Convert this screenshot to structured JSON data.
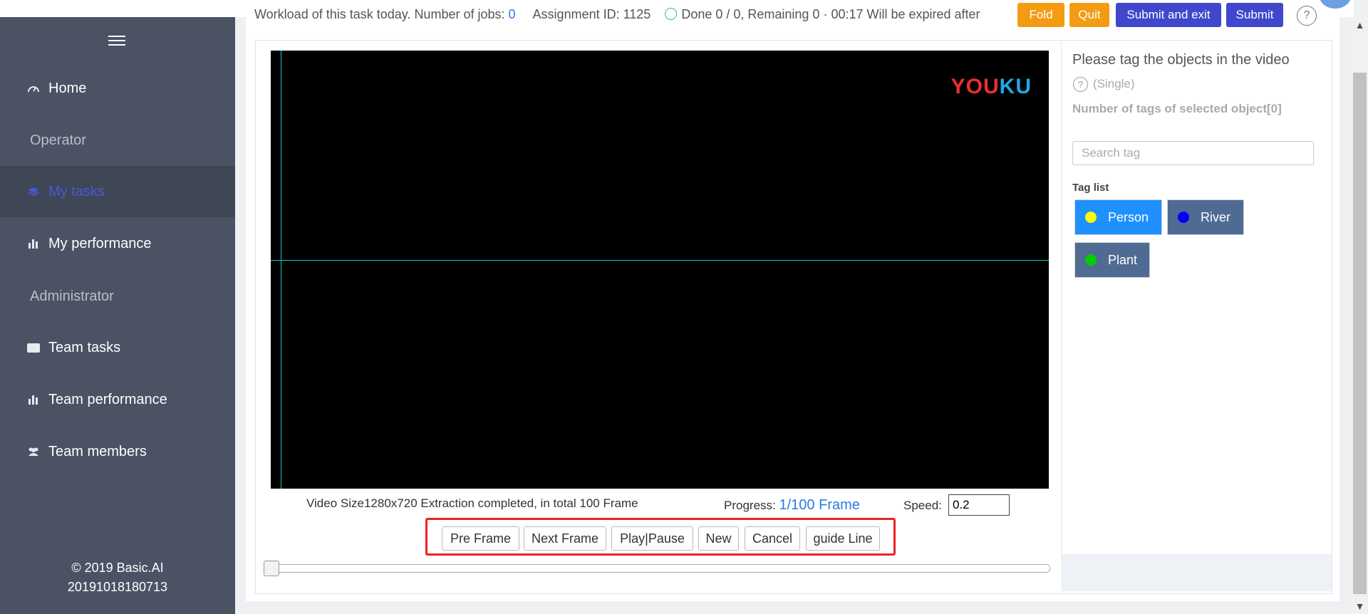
{
  "header": {
    "workload_text": "Workload of this task today. Number of jobs:",
    "jobs_count": "0",
    "assignment_text": "Assignment ID: 1125",
    "status_text": "Done 0 / 0, Remaining 0 · 00:17 Will be expired after",
    "buttons": {
      "fold": "Fold",
      "quit": "Quit",
      "submit_exit": "Submit and exit",
      "submit": "Submit"
    },
    "help": "?"
  },
  "sidebar": {
    "items": [
      {
        "label": "Home",
        "icon": "dashboard-icon"
      },
      {
        "label": "My tasks",
        "icon": "layers-icon",
        "active": true
      },
      {
        "label": "My performance",
        "icon": "bar-chart-icon"
      },
      {
        "label": "Team tasks",
        "icon": "folder-icon"
      },
      {
        "label": "Team performance",
        "icon": "bar-chart-icon"
      },
      {
        "label": "Team members",
        "icon": "users-icon"
      }
    ],
    "sections": {
      "operator": "Operator",
      "administrator": "Administrator"
    },
    "footer": {
      "copyright": "© 2019 Basic.AI",
      "version": "20191018180713"
    }
  },
  "video": {
    "logo_you": "YOU",
    "logo_ku": "KU",
    "info": "Video Size1280x720 Extraction completed, in total 100 Frame",
    "progress_label": "Progress:",
    "progress_value": "1/100 Frame",
    "speed_label": "Speed:",
    "speed_value": "0.2",
    "slider_position": 0.0
  },
  "controls": {
    "pre_frame": "Pre Frame",
    "next_frame": "Next Frame",
    "play_pause": "Play|Pause",
    "new": "New",
    "cancel": "Cancel",
    "guide_line": "guide Line"
  },
  "tag_panel": {
    "title": "Please tag the objects in the video",
    "help": "?",
    "mode": "(Single)",
    "count_text": "Number of tags of selected object[0]",
    "search_placeholder": "Search tag",
    "list_label": "Tag list",
    "tags": [
      {
        "label": "Person",
        "dot_color": "#ffff00",
        "bg_color": "#1e90ff"
      },
      {
        "label": "River",
        "dot_color": "#0000ff",
        "bg_color": "#4f6b94"
      },
      {
        "label": "Plant",
        "dot_color": "#00cc00",
        "bg_color": "#4f6b94"
      }
    ]
  },
  "colors": {
    "sidebar_bg": "#4a5264",
    "accent_blue": "#2a7ae2",
    "orange": "#f39c12",
    "indigo": "#3f48cc",
    "highlight_red": "#ee2222"
  }
}
